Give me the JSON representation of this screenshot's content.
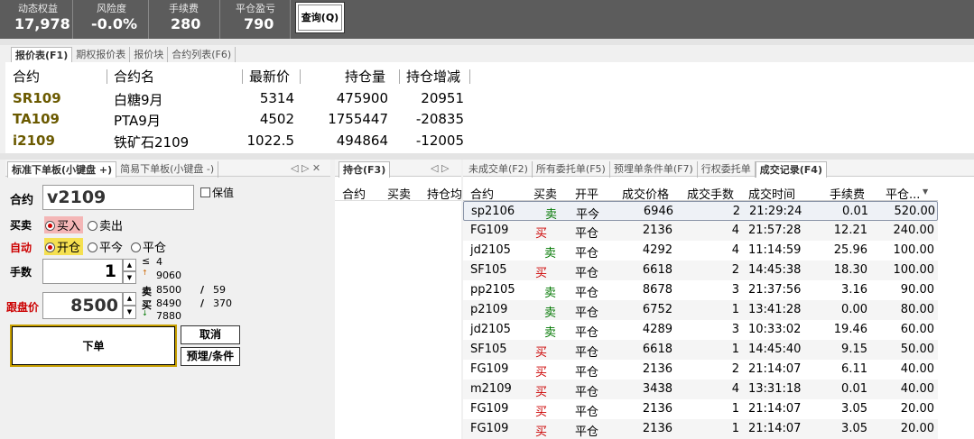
{
  "topbar": {
    "stats": [
      {
        "label": "动态权益",
        "value": "17,978"
      },
      {
        "label": "风险度",
        "value": "-0.0%"
      },
      {
        "label": "手续费",
        "value": "280"
      },
      {
        "label": "平仓盈亏",
        "value": "790"
      }
    ],
    "query_button": "查询(Q)"
  },
  "quote_tabs": [
    "报价表(F1)",
    "期权报价表",
    "报价块",
    "合约列表(F6)"
  ],
  "quote_table": {
    "headers": [
      "合约",
      "合约名",
      "最新价",
      "持仓量",
      "持仓增减"
    ],
    "rows": [
      {
        "code": "SR109",
        "name": "白糖9月",
        "price": "5314",
        "oi": "475900",
        "change": "20951"
      },
      {
        "code": "TA109",
        "name": "PTA9月",
        "price": "4502",
        "oi": "1755447",
        "change": "-20835"
      },
      {
        "code": "i2109",
        "name": "铁矿石2109",
        "price": "1022.5",
        "oi": "494864",
        "change": "-12005"
      }
    ]
  },
  "order_tabs": [
    "标准下单板(小键盘 +)",
    "简易下单板(小键盘 -)"
  ],
  "order": {
    "contract_label": "合约",
    "contract_value": "v2109",
    "guarantee_label": "保值",
    "side_label": "买卖",
    "buy": "买入",
    "sell": "卖出",
    "auto_label": "自动",
    "open": "开仓",
    "close_today": "平今",
    "close": "平仓",
    "qty_label": "手数",
    "qty_value": "1",
    "qty_le": "≤",
    "qty_max": "4",
    "price_label": "跟盘价",
    "price_value": "8500",
    "depth_up": "9060",
    "ask_label": "卖",
    "ask_price": "8500",
    "ask_sep": "/",
    "ask_vol": "59",
    "bid_label": "买",
    "bid_price": "8490",
    "bid_sep": "/",
    "bid_vol": "370",
    "depth_down": "7880",
    "submit": "下单",
    "cancel": "取消",
    "preorder": "预埋/条件"
  },
  "position_tab": "持仓(F3)",
  "position_headers": [
    "合约",
    "买卖",
    "持仓均"
  ],
  "trade_tabs": [
    "未成交单(F2)",
    "所有委托单(F5)",
    "预埋单条件单(F7)",
    "行权委托单",
    "成交记录(F4)"
  ],
  "trade_headers": [
    "合约",
    "买卖",
    "开平",
    "成交价格",
    "成交手数",
    "成交时间",
    "手续费",
    "平仓..."
  ],
  "trades": [
    {
      "code": "sp2106",
      "side": "卖",
      "oc": "平今",
      "price": "6946",
      "qty": "2",
      "time": "21:29:24",
      "fee": "0.01",
      "pnl": "520.00"
    },
    {
      "code": "FG109",
      "side": "买",
      "oc": "平仓",
      "price": "2136",
      "qty": "4",
      "time": "21:57:28",
      "fee": "12.21",
      "pnl": "240.00"
    },
    {
      "code": "jd2105",
      "side": "卖",
      "oc": "平仓",
      "price": "4292",
      "qty": "4",
      "time": "11:14:59",
      "fee": "25.96",
      "pnl": "100.00"
    },
    {
      "code": "SF105",
      "side": "买",
      "oc": "平仓",
      "price": "6618",
      "qty": "2",
      "time": "14:45:38",
      "fee": "18.30",
      "pnl": "100.00"
    },
    {
      "code": "pp2105",
      "side": "卖",
      "oc": "平仓",
      "price": "8678",
      "qty": "3",
      "time": "21:37:56",
      "fee": "3.16",
      "pnl": "90.00"
    },
    {
      "code": "p2109",
      "side": "卖",
      "oc": "平仓",
      "price": "6752",
      "qty": "1",
      "time": "13:41:28",
      "fee": "0.00",
      "pnl": "80.00"
    },
    {
      "code": "jd2105",
      "side": "卖",
      "oc": "平仓",
      "price": "4289",
      "qty": "3",
      "time": "10:33:02",
      "fee": "19.46",
      "pnl": "60.00"
    },
    {
      "code": "SF105",
      "side": "买",
      "oc": "平仓",
      "price": "6618",
      "qty": "1",
      "time": "14:45:40",
      "fee": "9.15",
      "pnl": "50.00"
    },
    {
      "code": "FG109",
      "side": "买",
      "oc": "平仓",
      "price": "2136",
      "qty": "2",
      "time": "21:14:07",
      "fee": "6.11",
      "pnl": "40.00"
    },
    {
      "code": "m2109",
      "side": "买",
      "oc": "平仓",
      "price": "3438",
      "qty": "4",
      "time": "13:31:18",
      "fee": "0.01",
      "pnl": "40.00"
    },
    {
      "code": "FG109",
      "side": "买",
      "oc": "平仓",
      "price": "2136",
      "qty": "1",
      "time": "21:14:07",
      "fee": "3.05",
      "pnl": "20.00"
    },
    {
      "code": "FG109",
      "side": "买",
      "oc": "平仓",
      "price": "2136",
      "qty": "1",
      "time": "21:14:07",
      "fee": "3.05",
      "pnl": "20.00"
    }
  ]
}
